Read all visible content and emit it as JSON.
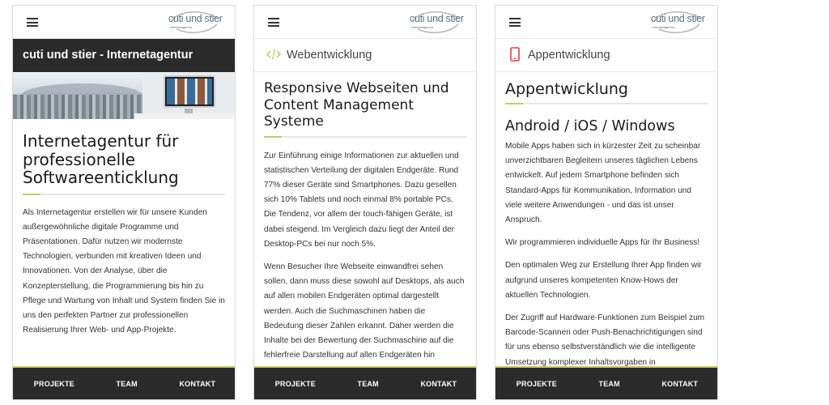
{
  "brand": {
    "logo_text": "cuti und stier",
    "logo_subtext": "Internetagentur",
    "accent_color": "#c8c86a",
    "dark_color": "#2b2b2b"
  },
  "nav": [
    "PROJEKTE",
    "TEAM",
    "KONTAKT"
  ],
  "screens": [
    {
      "bar_title": "cuti und stier - Internetagentur",
      "heading": "Internetagentur für professionelle Softwareenticklung",
      "paragraphs": [
        "Als Internetagentur erstellen wir für unsere Kunden außergewöhnliche digitale Programme und Präsentationen. Dafür nutzen wir modernste Technologien, verbunden mit kreativen Ideen und Innovationen. Von der Analyse, über die Konzepterstellung, die Programmierung bis hin zu Pflege und Wartung von Inhalt und System finden Sie in uns den perfekten Partner zur professionellen Realisierung Ihrer Web- und App-Projekte."
      ]
    },
    {
      "section_icon": "code-icon",
      "section_label": "Webentwicklung",
      "heading": "Responsive Webseiten und Content Management Systeme",
      "paragraphs": [
        "Zur Einführung einige Informationen zur aktuellen und statistischen Verteilung der digitalen Endgeräte. Rund 77% dieser Geräte sind Smartphones. Dazu gesellen sich 10% Tablets und noch einmal 8% portable PCs. Die Tendenz, vor allem der touch-fähigen Geräte, ist dabei steigend. Im Vergleich dazu liegt der Anteil der Desktop-PCs bei nur noch 5%.",
        "Wenn Besucher Ihre Webseite einwandfrei sehen sollen, dann muss diese sowohl auf Desktops, als auch auf allen mobilen Endgeräten optimal dargestellt werden. Auch die Suchmaschinen haben die Bedeutung dieser Zahlen erkannt. Daher werden die Inhalte bei der Bewertung der Suchmaschine auf die fehlerfreie Darstellung auf allen Endgeräten hin"
      ]
    },
    {
      "section_icon": "smartphone-icon",
      "section_label": "Appentwicklung",
      "heading": "Appentwicklung",
      "subheading": "Android / iOS / Windows",
      "paragraphs": [
        "Mobile Apps haben sich in kürzester Zeit zu scheinbar unverzichtbaren Begleitern unseres täglichen Lebens entwickelt. Auf jedem Smartphone befinden sich Standard-Apps für Kommunikation, Information und viele weitere Anwendungen - und das ist unser Anspruch.",
        "Wir programmieren individuelle Apps für Ihr Business!",
        "Den optimalen Weg zur Erstellung Ihrer App finden wir aufgrund unseres kompetenten Know-Hows der aktuellen Technologien.",
        "Der Zugriff auf Hardware-Funktionen zum Beispiel zum Barcode-Scannen oder Push-Benachrichtigungen sind für uns ebenso selbstverständlich wie die intelligente Umsetzung komplexer Inhaltsvorgaben in"
      ]
    }
  ]
}
